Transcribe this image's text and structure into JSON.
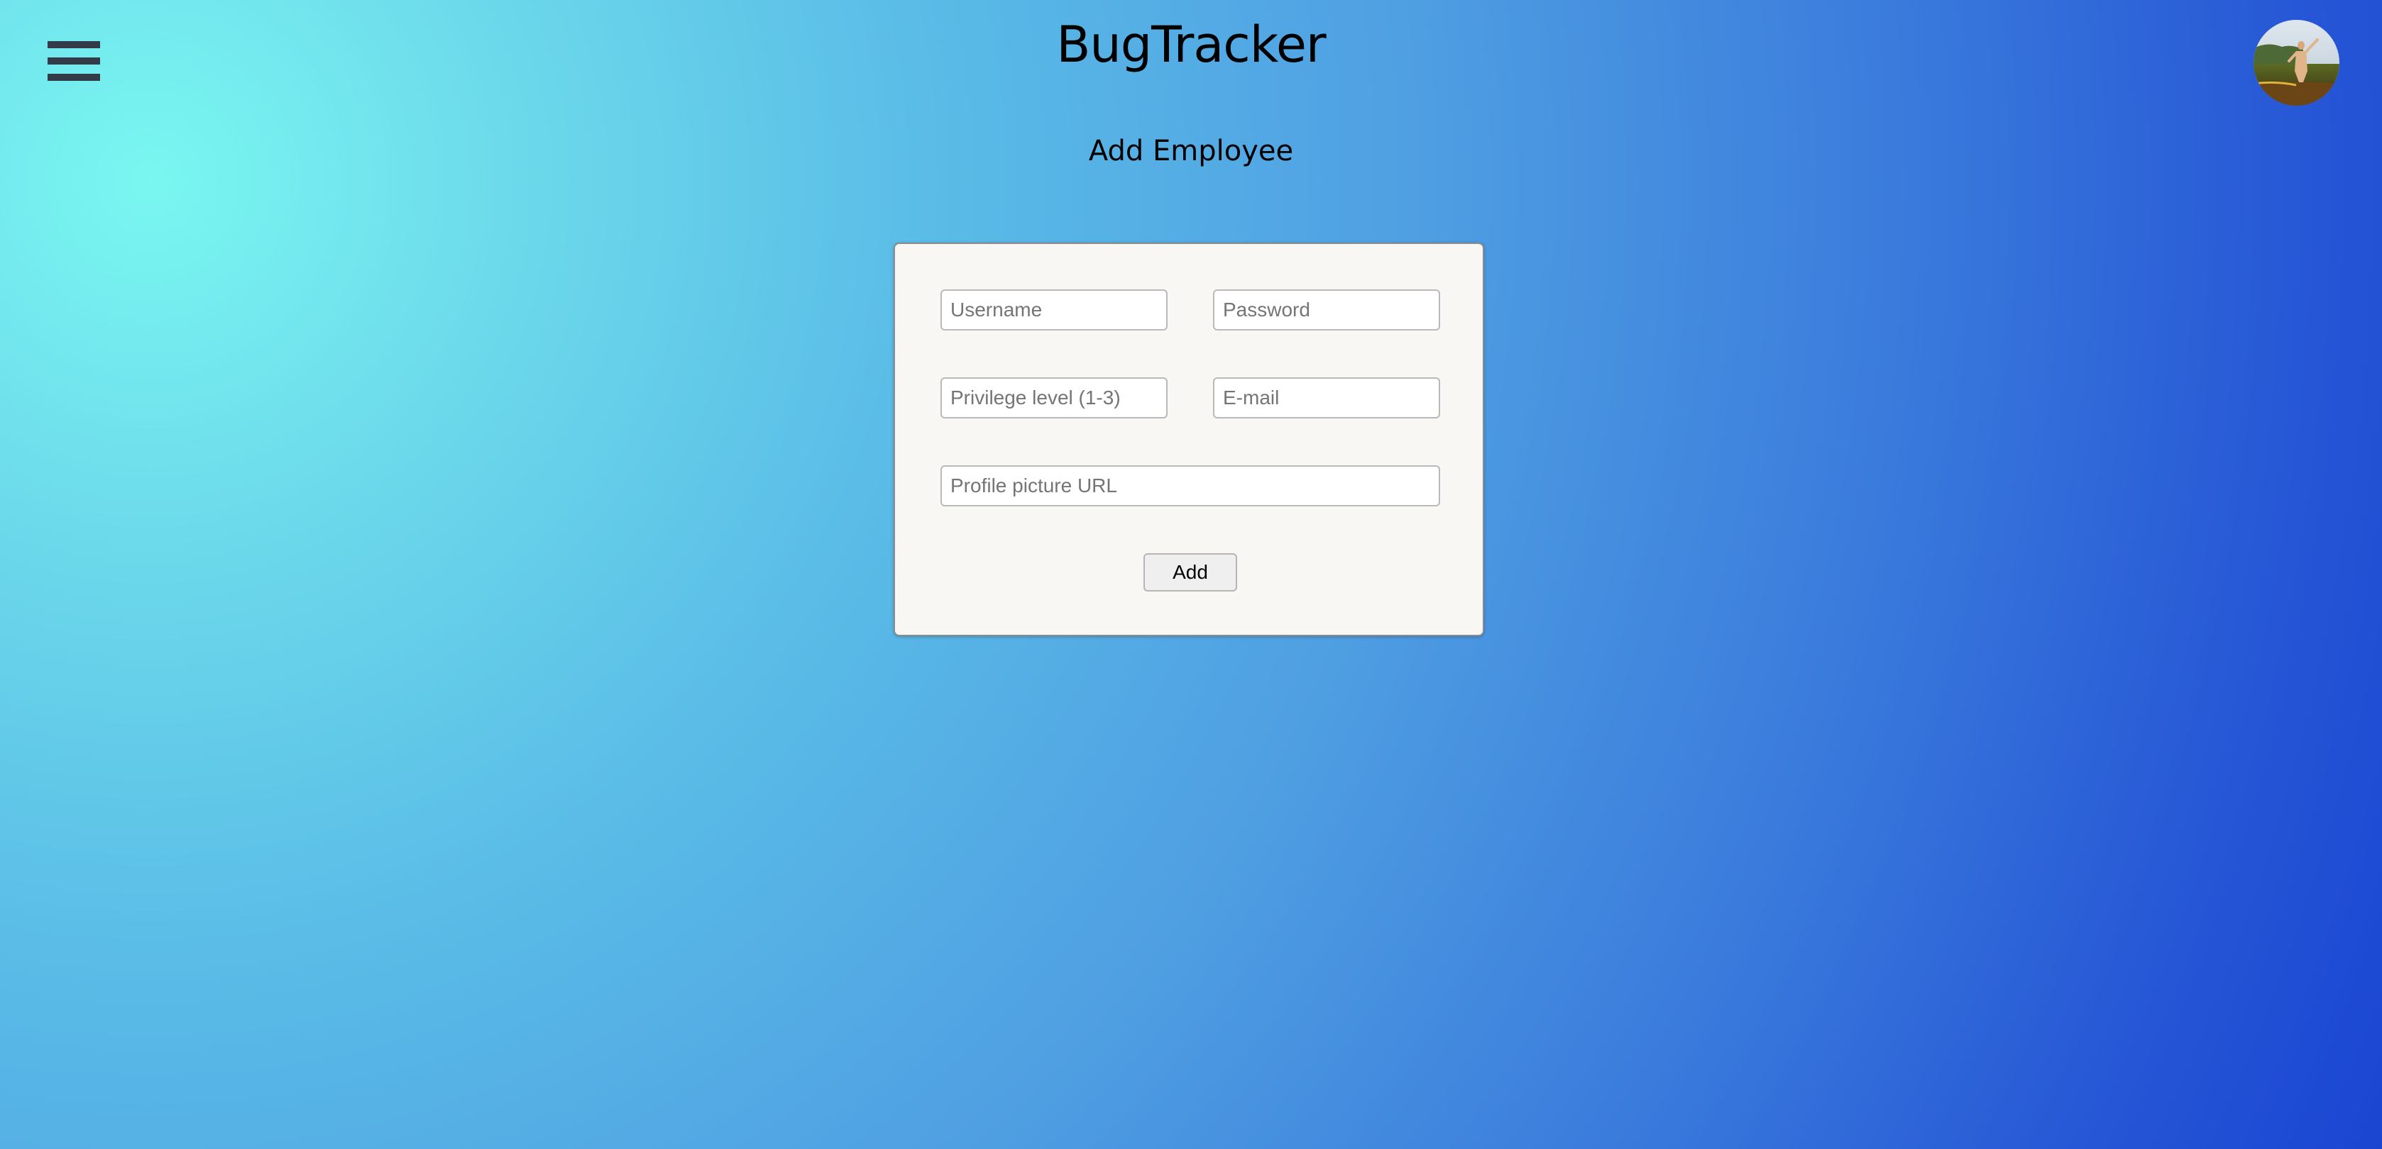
{
  "header": {
    "title": "BugTracker",
    "menu_icon": "hamburger-menu-icon",
    "avatar_icon": "user-avatar"
  },
  "page": {
    "heading": "Add Employee"
  },
  "form": {
    "username_placeholder": "Username",
    "password_placeholder": "Password",
    "privilege_placeholder": "Privilege level (1-3)",
    "email_placeholder": "E-mail",
    "picture_placeholder": "Profile picture URL",
    "add_label": "Add"
  },
  "colors": {
    "gradient_light": "#7af7f1",
    "gradient_dark": "#1a45d2",
    "card_background": "#f9f7f3",
    "menu_icon": "#333a48"
  }
}
